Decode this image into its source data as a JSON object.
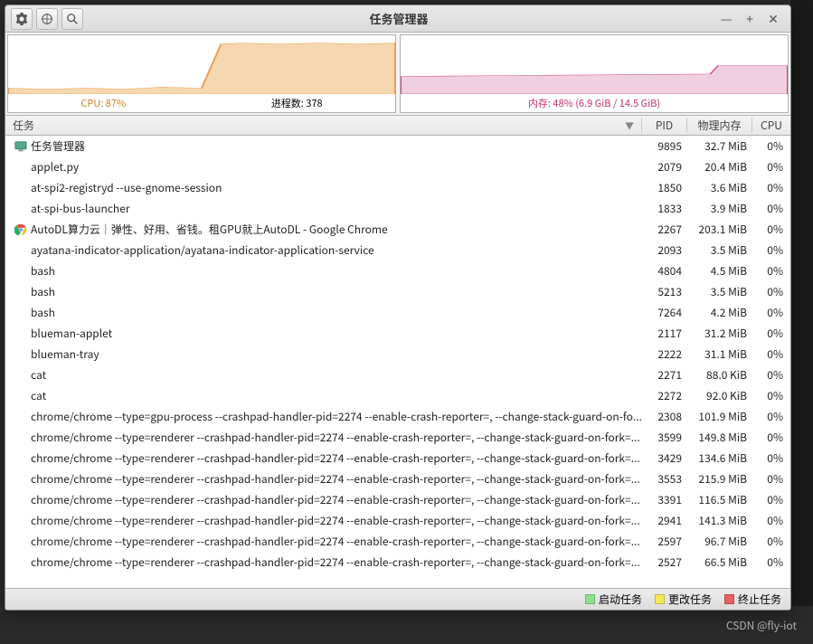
{
  "window": {
    "title": "任务管理器"
  },
  "graphs": {
    "cpu_label": "CPU: 87%",
    "proc_label": "进程数: 378",
    "mem_label": "内存: 48% (6.9 GiB / 14.5 GiB)"
  },
  "headers": {
    "task": "任务",
    "pid": "PID",
    "mem": "物理内存",
    "cpu": "CPU"
  },
  "legend": {
    "start": "启动任务",
    "change": "更改任务",
    "stop": "终止任务"
  },
  "watermark": "CSDN @fly-iot",
  "processes": [
    {
      "name": "任务管理器",
      "pid": "9895",
      "mem": "32.7 MiB",
      "cpu": "0%",
      "icon": "monitor",
      "indent": false
    },
    {
      "name": "applet.py",
      "pid": "2079",
      "mem": "20.4 MiB",
      "cpu": "0%",
      "indent": true
    },
    {
      "name": "at-spi2-registryd --use-gnome-session",
      "pid": "1850",
      "mem": "3.6 MiB",
      "cpu": "0%",
      "indent": true
    },
    {
      "name": "at-spi-bus-launcher",
      "pid": "1833",
      "mem": "3.9 MiB",
      "cpu": "0%",
      "indent": true
    },
    {
      "name": "AutoDL算力云｜弹性、好用、省钱。租GPU就上AutoDL - Google Chrome",
      "pid": "2267",
      "mem": "203.1 MiB",
      "cpu": "0%",
      "icon": "chrome",
      "indent": false
    },
    {
      "name": "ayatana-indicator-application/ayatana-indicator-application-service",
      "pid": "2093",
      "mem": "3.5 MiB",
      "cpu": "0%",
      "indent": true
    },
    {
      "name": "bash",
      "pid": "4804",
      "mem": "4.5 MiB",
      "cpu": "0%",
      "indent": true
    },
    {
      "name": "bash",
      "pid": "5213",
      "mem": "3.5 MiB",
      "cpu": "0%",
      "indent": true
    },
    {
      "name": "bash",
      "pid": "7264",
      "mem": "4.2 MiB",
      "cpu": "0%",
      "indent": true
    },
    {
      "name": "blueman-applet",
      "pid": "2117",
      "mem": "31.2 MiB",
      "cpu": "0%",
      "indent": true
    },
    {
      "name": "blueman-tray",
      "pid": "2222",
      "mem": "31.1 MiB",
      "cpu": "0%",
      "indent": true
    },
    {
      "name": "cat",
      "pid": "2271",
      "mem": "88.0 KiB",
      "cpu": "0%",
      "indent": true
    },
    {
      "name": "cat",
      "pid": "2272",
      "mem": "92.0 KiB",
      "cpu": "0%",
      "indent": true
    },
    {
      "name": "chrome/chrome --type=gpu-process --crashpad-handler-pid=2274 --enable-crash-reporter=, --change-stack-guard-on-fo...",
      "pid": "2308",
      "mem": "101.9 MiB",
      "cpu": "0%",
      "indent": true
    },
    {
      "name": "chrome/chrome --type=renderer --crashpad-handler-pid=2274 --enable-crash-reporter=, --change-stack-guard-on-fork=...",
      "pid": "3599",
      "mem": "149.8 MiB",
      "cpu": "0%",
      "indent": true
    },
    {
      "name": "chrome/chrome --type=renderer --crashpad-handler-pid=2274 --enable-crash-reporter=, --change-stack-guard-on-fork=...",
      "pid": "3429",
      "mem": "134.6 MiB",
      "cpu": "0%",
      "indent": true
    },
    {
      "name": "chrome/chrome --type=renderer --crashpad-handler-pid=2274 --enable-crash-reporter=, --change-stack-guard-on-fork=...",
      "pid": "3553",
      "mem": "215.9 MiB",
      "cpu": "0%",
      "indent": true
    },
    {
      "name": "chrome/chrome --type=renderer --crashpad-handler-pid=2274 --enable-crash-reporter=, --change-stack-guard-on-fork=...",
      "pid": "3391",
      "mem": "116.5 MiB",
      "cpu": "0%",
      "indent": true
    },
    {
      "name": "chrome/chrome --type=renderer --crashpad-handler-pid=2274 --enable-crash-reporter=, --change-stack-guard-on-fork=...",
      "pid": "2941",
      "mem": "141.3 MiB",
      "cpu": "0%",
      "indent": true
    },
    {
      "name": "chrome/chrome --type=renderer --crashpad-handler-pid=2274 --enable-crash-reporter=, --change-stack-guard-on-fork=...",
      "pid": "2597",
      "mem": "96.7 MiB",
      "cpu": "0%",
      "indent": true
    },
    {
      "name": "chrome/chrome --type=renderer --crashpad-handler-pid=2274 --enable-crash-reporter=, --change-stack-guard-on-fork=...",
      "pid": "2527",
      "mem": "66.5 MiB",
      "cpu": "0%",
      "indent": true
    }
  ],
  "chart_data": [
    {
      "type": "area",
      "title": "CPU",
      "x": [
        0,
        10,
        20,
        30,
        40,
        50,
        55,
        60,
        70,
        80,
        90,
        100
      ],
      "values": [
        10,
        9,
        11,
        10,
        12,
        11,
        85,
        87,
        86,
        87,
        86,
        87
      ],
      "ylim": [
        0,
        100
      ],
      "color": "#e8a050"
    },
    {
      "type": "area",
      "title": "Memory",
      "x": [
        0,
        10,
        20,
        30,
        40,
        50,
        60,
        70,
        80,
        82,
        90,
        100
      ],
      "values": [
        30,
        30.5,
        31,
        31.5,
        32,
        32.5,
        33,
        33.5,
        34,
        48,
        48,
        48
      ],
      "ylim": [
        0,
        100
      ],
      "color": "#d05090"
    }
  ]
}
